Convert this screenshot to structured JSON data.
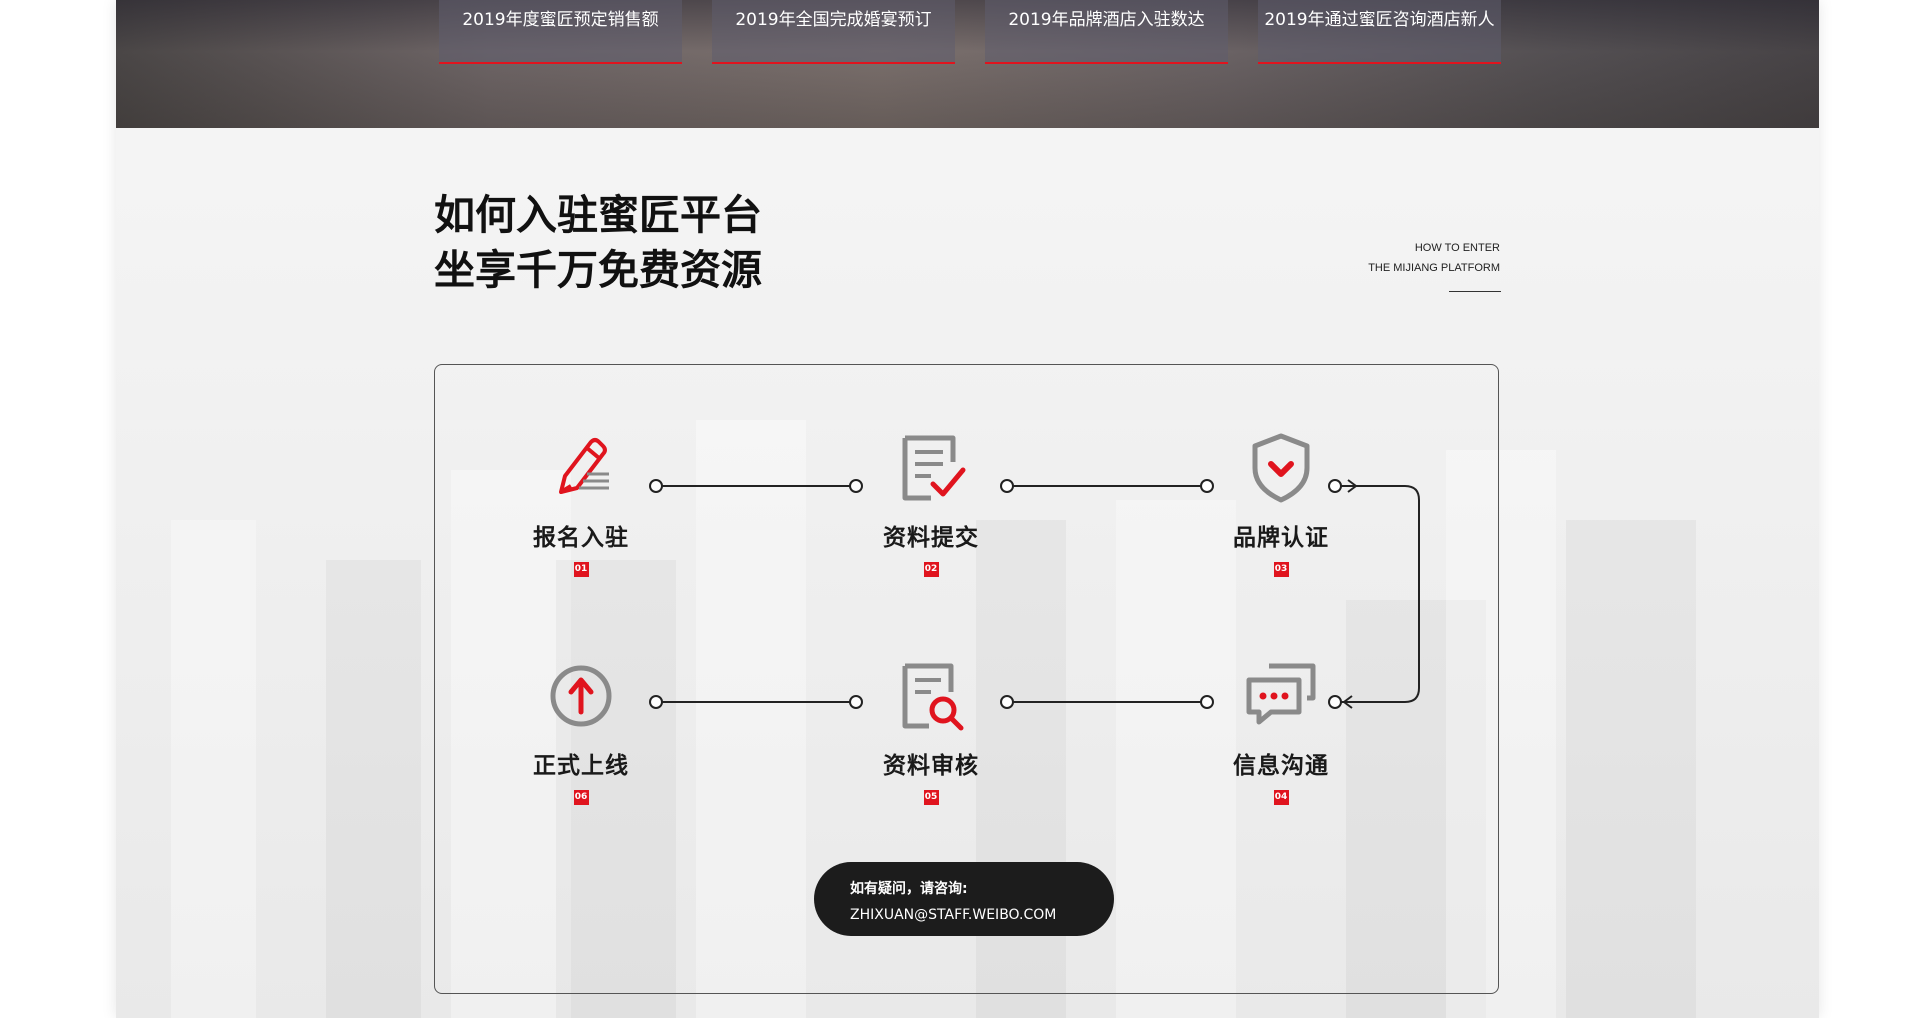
{
  "stats": [
    {
      "label": "2019年度蜜匠预定销售额"
    },
    {
      "label": "2019年全国完成婚宴预订"
    },
    {
      "label": "2019年品牌酒店入驻数达"
    },
    {
      "label": "2019年通过蜜匠咨询酒店新人"
    }
  ],
  "heading": {
    "line1": "如何入驻蜜匠平台",
    "line2": "坐享千万免费资源",
    "en_line1": "HOW TO ENTER",
    "en_line2": "THE MIJIANG PLATFORM"
  },
  "steps": [
    {
      "label": "报名入驻",
      "num": "01",
      "icon": "edit-pencil-icon"
    },
    {
      "label": "资料提交",
      "num": "02",
      "icon": "document-check-icon"
    },
    {
      "label": "品牌认证",
      "num": "03",
      "icon": "shield-check-icon"
    },
    {
      "label": "信息沟通",
      "num": "04",
      "icon": "chat-bubbles-icon"
    },
    {
      "label": "资料审核",
      "num": "05",
      "icon": "document-search-icon"
    },
    {
      "label": "正式上线",
      "num": "06",
      "icon": "arrow-up-circle-icon"
    }
  ],
  "contact": {
    "question": "如有疑问，请咨询:",
    "email": "ZHIXUAN@STAFF.WEIBO.COM"
  },
  "colors": {
    "accent": "#e0141e",
    "icon_gray": "#8a8a8a",
    "dark": "#1c1c1c"
  }
}
